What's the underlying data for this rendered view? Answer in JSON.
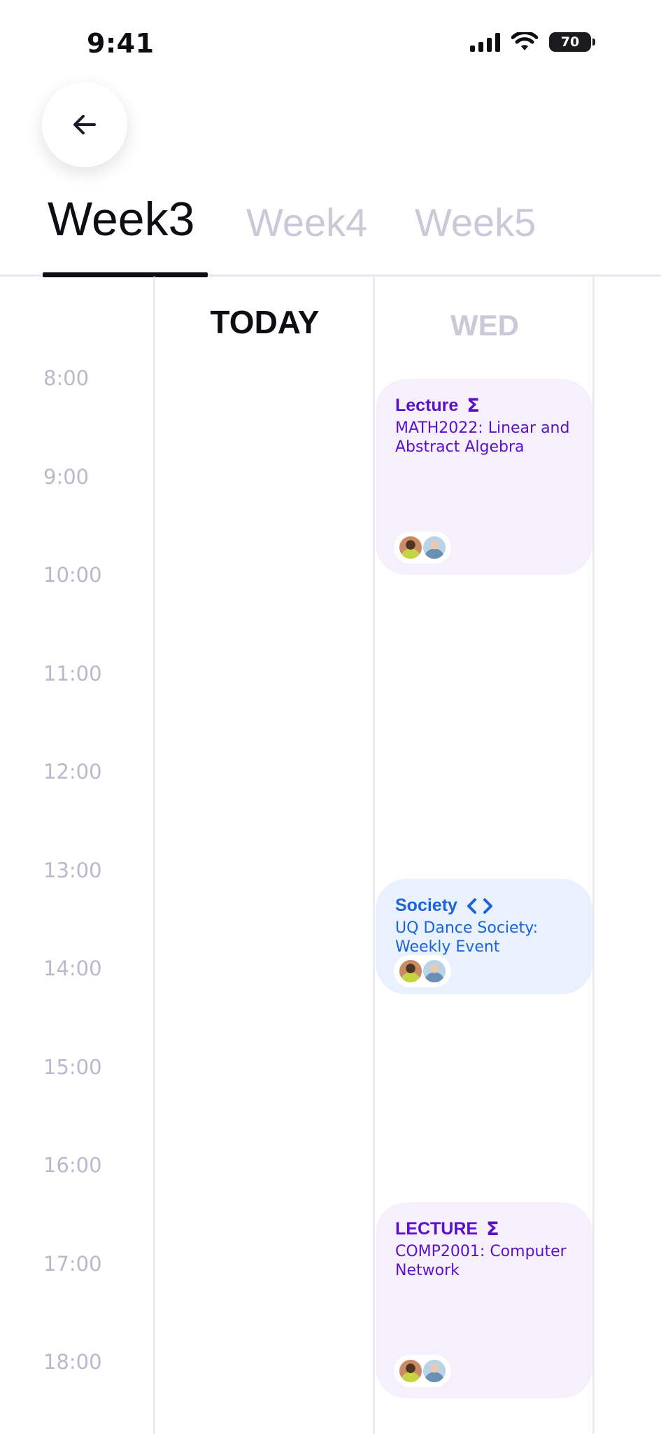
{
  "status_bar": {
    "time": "9:41",
    "battery": "70"
  },
  "tabs": [
    {
      "label": "Week3",
      "active": true
    },
    {
      "label": "Week4",
      "active": false
    },
    {
      "label": "Week5",
      "active": false
    }
  ],
  "days": {
    "today": "TODAY",
    "wed": "WED"
  },
  "times": [
    "8:00",
    "9:00",
    "10:00",
    "11:00",
    "12:00",
    "13:00",
    "14:00",
    "15:00",
    "16:00",
    "17:00",
    "18:00"
  ],
  "events": [
    {
      "type": "Lecture",
      "icon": "sigma-icon",
      "title": "MATH2022: Linear and Abstract Algebra",
      "color": "#5b11c7",
      "background": "#f5f0fc"
    },
    {
      "type": "Society",
      "icon": "code-brackets-icon",
      "title": "UQ Dance Society: Weekly Event",
      "color": "#1e64d8",
      "background": "#e9f1fd"
    },
    {
      "type": "LECTURE",
      "icon": "sigma-icon",
      "title": "COMP2001:  Computer Network",
      "color": "#5b11c7",
      "background": "#f5f0fc"
    }
  ],
  "colors": {
    "accent_dark": "#0d0d12",
    "inactive": "#c9c9d8",
    "time_label": "#b9b9cc"
  }
}
